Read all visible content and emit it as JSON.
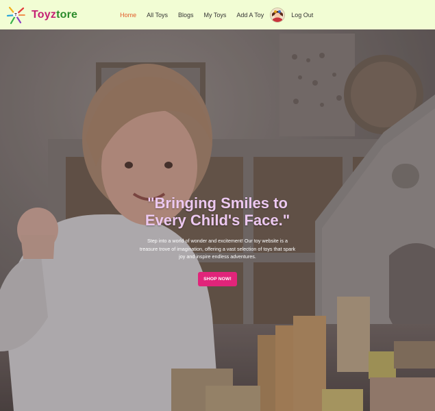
{
  "brand": {
    "part1": "Toyz",
    "part2": "tore"
  },
  "nav": {
    "home": "Home",
    "all_toys": "All Toys",
    "blogs": "Blogs",
    "my_toys": "My Toys",
    "add_toy": "Add A Toy",
    "logout": "Log Out"
  },
  "hero": {
    "headline": "\"Bringing Smiles to Every Child's Face.\"",
    "subtext": "Step into a world of wonder and excitement! Our toy website is a treasure trove of imagination, offering a vast selection of toys that spark joy and inspire endless adventures.",
    "cta_label": "SHOP NOW!"
  },
  "colors": {
    "navbar_bg": "#f2fdd4",
    "brand_primary": "#c41f73",
    "brand_secondary": "#2c8b2b",
    "nav_active": "#e15a27",
    "cta_bg": "#e1247a",
    "headline": "#ecc8f0"
  },
  "icons": {
    "logo": "colorful-star-logo-icon",
    "avatar": "user-avatar"
  }
}
